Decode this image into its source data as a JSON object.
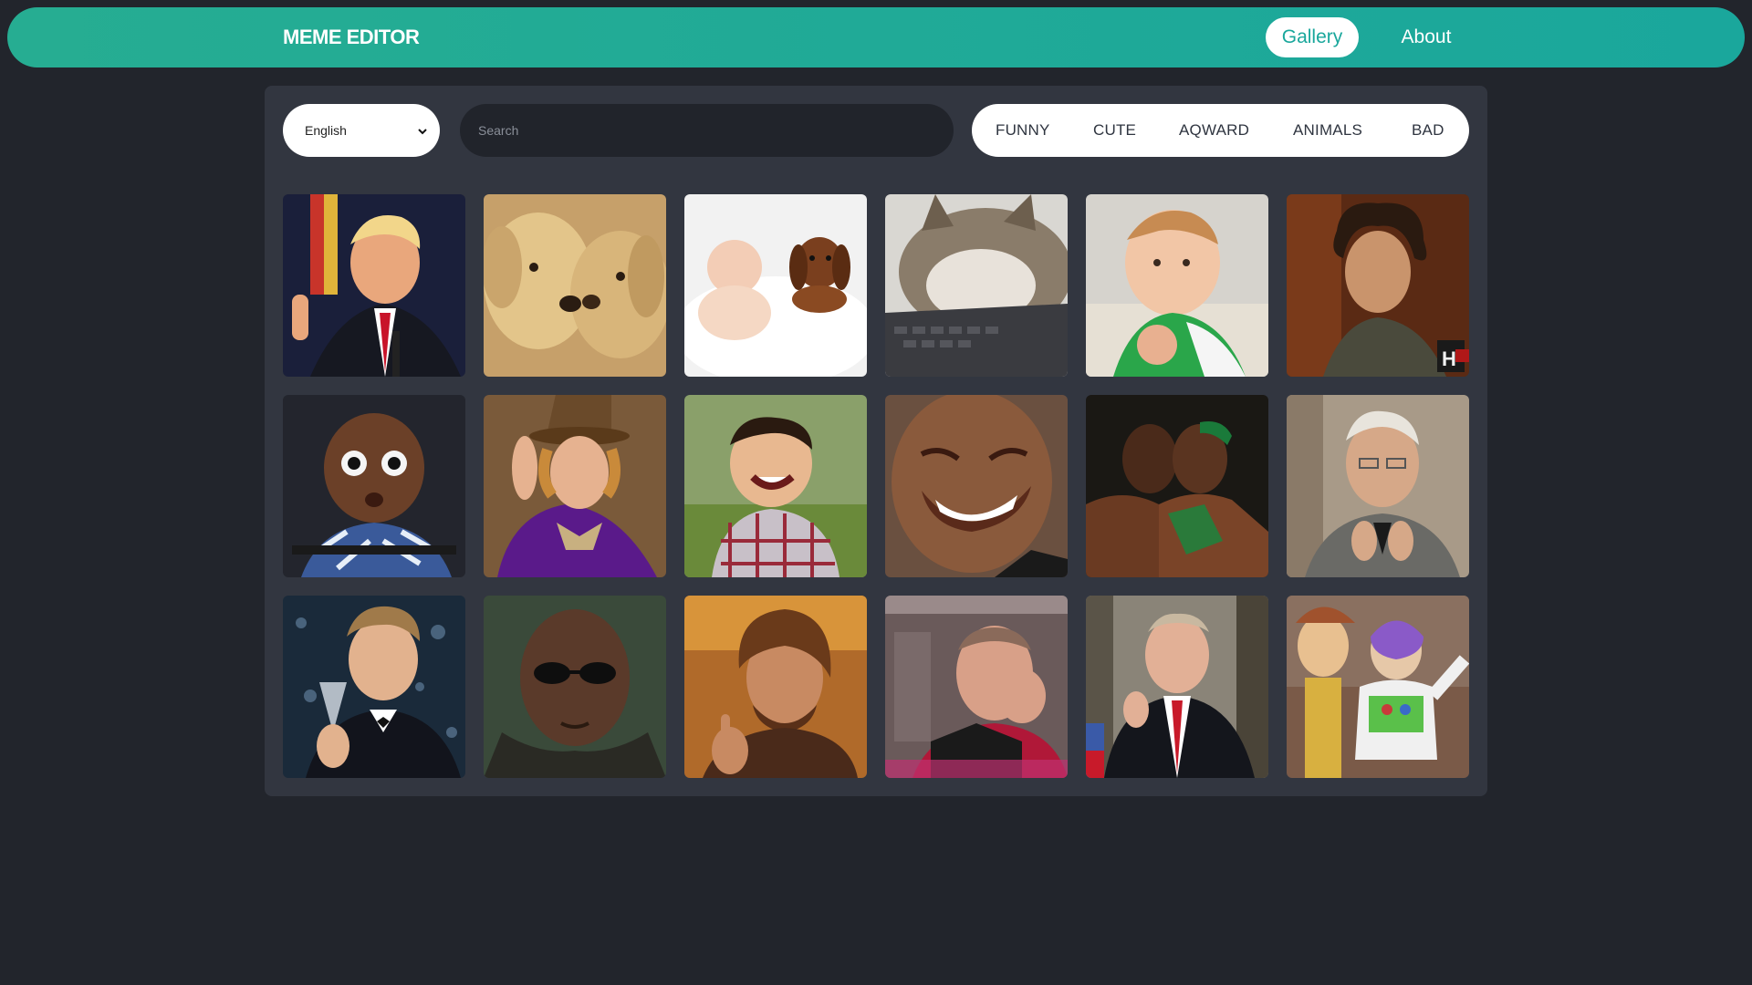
{
  "header": {
    "logo": "MEME EDITOR",
    "nav": {
      "gallery": "Gallery",
      "about": "About"
    }
  },
  "toolbar": {
    "language": {
      "selected": "English"
    },
    "search": {
      "placeholder": "Search"
    },
    "tags": [
      "FUNNY",
      "CUTE",
      "AQWARD",
      "ANIMALS",
      "BAD"
    ]
  },
  "colors": {
    "accent": "#1aa79c",
    "background": "#22252c",
    "panel": "#323640"
  }
}
